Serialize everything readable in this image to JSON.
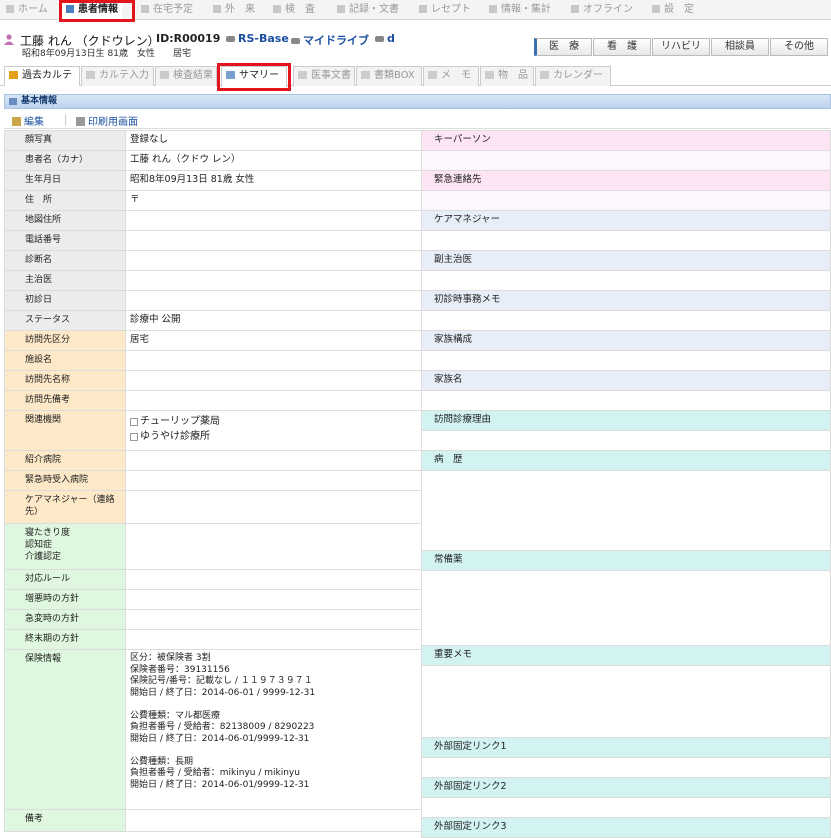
{
  "nav": {
    "items": [
      {
        "label": "ホーム",
        "icon": "home-icon",
        "active": false
      },
      {
        "label": "患者情報",
        "icon": "patient-icon",
        "active": true
      },
      {
        "label": "在宅予定",
        "icon": "schedule-icon",
        "active": false
      },
      {
        "label": "外　来",
        "icon": "outpatient-icon",
        "active": false
      },
      {
        "label": "検　査",
        "icon": "exam-icon",
        "active": false
      },
      {
        "label": "記録・文書",
        "icon": "record-icon",
        "active": false
      },
      {
        "label": "レセプト",
        "icon": "receipt-icon",
        "active": false
      },
      {
        "label": "情報・集計",
        "icon": "stats-icon",
        "active": false
      },
      {
        "label": "オフライン",
        "icon": "offline-icon",
        "active": false
      },
      {
        "label": "設　定",
        "icon": "settings-icon",
        "active": false
      }
    ]
  },
  "patient": {
    "name": "工藤 れん （クドウレン）",
    "id": "ID:R00019",
    "links": [
      "RS-Base",
      "マイドライブ",
      "d"
    ],
    "sub": "昭和8年09月13日生 81歳　女性　　居宅"
  },
  "right_buttons": [
    "医　療",
    "看　護",
    "リハビリ",
    "相談員",
    "その他"
  ],
  "tabs": [
    {
      "label": "過去カルテ"
    },
    {
      "label": "カルテ入力"
    },
    {
      "label": "検査結果"
    },
    {
      "label": "サマリー"
    },
    {
      "label": "医事文書"
    },
    {
      "label": "書類BOX"
    },
    {
      "label": "メ　モ"
    },
    {
      "label": "物　品"
    },
    {
      "label": "カレンダー"
    }
  ],
  "section_title": "基本情報",
  "actions": {
    "edit": "編集",
    "print": "印刷用画面"
  },
  "left_fields": [
    {
      "label": "顔写真",
      "value": "登録なし",
      "color": "gray"
    },
    {
      "label": "患者名（カナ）",
      "value": "工藤 れん（クドウ レン）",
      "color": "gray"
    },
    {
      "label": "生年月日",
      "value": "昭和8年09月13日 81歳 女性",
      "color": "gray"
    },
    {
      "label": "住　所",
      "value": "〒",
      "color": "gray"
    },
    {
      "label": "地図住所",
      "value": "",
      "color": "gray"
    },
    {
      "label": "電話番号",
      "value": "",
      "color": "gray"
    },
    {
      "label": "診断名",
      "value": "",
      "color": "gray"
    },
    {
      "label": "主治医",
      "value": "",
      "color": "gray"
    },
    {
      "label": "初診日",
      "value": "",
      "color": "gray"
    },
    {
      "label": "ステータス",
      "value": "診療中 公開",
      "color": "gray"
    },
    {
      "label": "訪問先区分",
      "value": "居宅",
      "color": "peach"
    },
    {
      "label": "施設名",
      "value": "",
      "color": "peach"
    },
    {
      "label": "訪問先名称",
      "value": "",
      "color": "peach"
    },
    {
      "label": "訪問先備考",
      "value": "",
      "color": "peach"
    },
    {
      "label": "関連機関",
      "value": "",
      "color": "peach"
    },
    {
      "label": "紹介病院",
      "value": "",
      "color": "peach"
    },
    {
      "label": "緊急時受入病院",
      "value": "",
      "color": "peach"
    },
    {
      "label": "ケアマネジャー（連絡先）",
      "value": "",
      "color": "peach"
    },
    {
      "label": "寝たきり度\n認知症\n介護認定",
      "value": "",
      "color": "green"
    },
    {
      "label": "対応ルール",
      "value": "",
      "color": "green"
    },
    {
      "label": "増悪時の方針",
      "value": "",
      "color": "green"
    },
    {
      "label": "急変時の方針",
      "value": "",
      "color": "green"
    },
    {
      "label": "終末期の方針",
      "value": "",
      "color": "green"
    },
    {
      "label": "保険情報",
      "value": "",
      "color": "green"
    },
    {
      "label": "備考",
      "value": "",
      "color": "green"
    }
  ],
  "related": [
    "チューリップ薬局",
    "ゆうやけ診療所"
  ],
  "insurance": "区分：被保険者 3割\n保険者番号：39131156\n保険記号/番号：記載なし / １１９７３９７１\n開始日 / 終了日：2014-06-01 / 9999-12-31\n\n公費種類：マル都医療\n負担者番号 / 受給者：82138009 / 8290223\n開始日 / 終了日：2014-06-01/9999-12-31\n\n公費種類：長期\n負担者番号 / 受給者：mikinyu / mikinyu\n開始日 / 終了日：2014-06-01/9999-12-31",
  "right_fields": [
    "キーパーソン",
    "緊急連絡先",
    "ケアマネジャー",
    "副主治医",
    "初診時事務メモ",
    "家族構成",
    "家族名",
    "訪問診療理由",
    "病　歴",
    "常備薬",
    "重要メモ",
    "外部固定リンク1",
    "外部固定リンク2",
    "外部固定リンク3"
  ],
  "colors": {
    "highlight": "#e3141b",
    "link": "#1a4fa0",
    "pink": "#fde5f6",
    "blue": "#e7eef8",
    "cyan": "#d3f3f3"
  }
}
